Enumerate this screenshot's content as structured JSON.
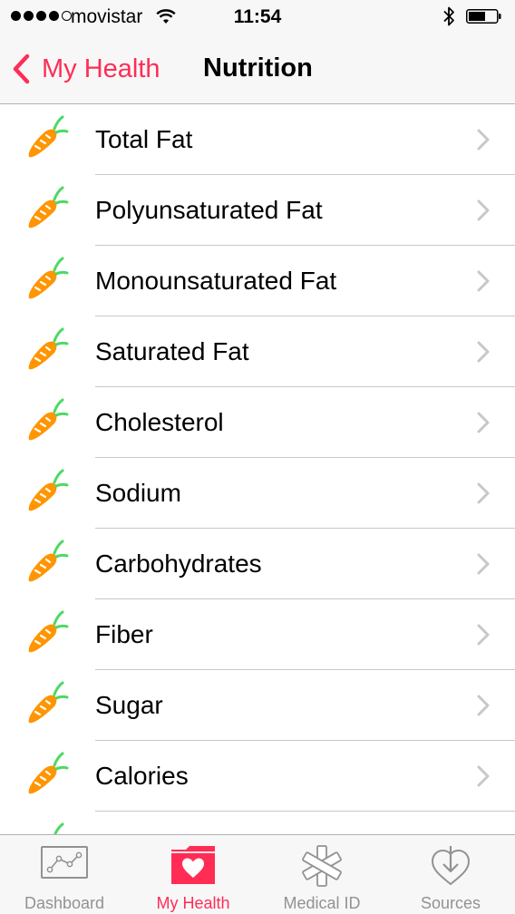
{
  "status_bar": {
    "carrier": "movistar",
    "time": "11:54",
    "signal_bars_filled": 4,
    "signal_bars_total": 5
  },
  "nav": {
    "back_label": "My Health",
    "title": "Nutrition"
  },
  "list": {
    "items": [
      {
        "label": "Total Fat",
        "icon": "carrot-icon"
      },
      {
        "label": "Polyunsaturated Fat",
        "icon": "carrot-icon"
      },
      {
        "label": "Monounsaturated Fat",
        "icon": "carrot-icon"
      },
      {
        "label": "Saturated Fat",
        "icon": "carrot-icon"
      },
      {
        "label": "Cholesterol",
        "icon": "carrot-icon"
      },
      {
        "label": "Sodium",
        "icon": "carrot-icon"
      },
      {
        "label": "Carbohydrates",
        "icon": "carrot-icon"
      },
      {
        "label": "Fiber",
        "icon": "carrot-icon"
      },
      {
        "label": "Sugar",
        "icon": "carrot-icon"
      },
      {
        "label": "Calories",
        "icon": "carrot-icon"
      }
    ]
  },
  "tab_bar": {
    "tabs": [
      {
        "label": "Dashboard",
        "icon": "dashboard-icon",
        "active": false
      },
      {
        "label": "My Health",
        "icon": "folder-heart-icon",
        "active": true
      },
      {
        "label": "Medical ID",
        "icon": "medical-asterisk-icon",
        "active": false
      },
      {
        "label": "Sources",
        "icon": "download-heart-icon",
        "active": false
      }
    ]
  },
  "colors": {
    "accent": "#ff2d55",
    "carrot_orange": "#ff9500",
    "carrot_leaf": "#4cd964",
    "inactive_tab": "#929292",
    "separator": "#c8c7cc",
    "bar_background": "#f7f7f8"
  }
}
